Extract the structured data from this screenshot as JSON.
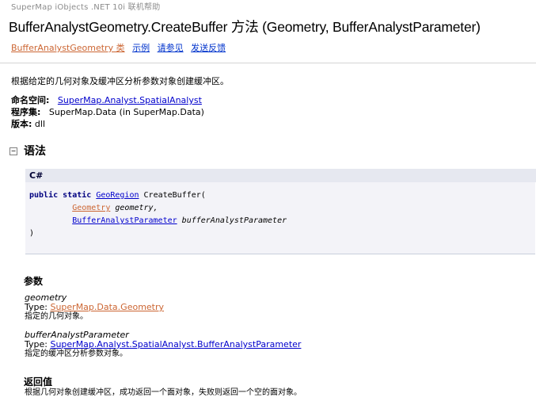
{
  "header": {
    "banner": "SuperMap iObjects .NET 10i 联机帮助",
    "title": "BufferAnalystGeometry.CreateBuffer 方法  (Geometry, BufferAnalystParameter)",
    "links": {
      "class_link": "BufferAnalystGeometry 类",
      "example": "示例",
      "see_also": "请参见",
      "feedback": "发送反馈"
    }
  },
  "description": "根据给定的几何对象及缓冲区分析参数对象创建缓冲区。",
  "meta": {
    "namespace_label": "命名空间:",
    "namespace_value": "SuperMap.Analyst.SpatialAnalyst",
    "assembly_label": "程序集:",
    "assembly_value": "SuperMap.Data (in SuperMap.Data)",
    "version_label": "版本:",
    "version_value": "dll"
  },
  "syntax": {
    "section_title": "语法",
    "toggle": "−",
    "language": "C#",
    "kw_public": "public",
    "kw_static": "static",
    "return_type": "GeoRegion",
    "method": "CreateBuffer(",
    "param1_type": "Geometry",
    "param1_name": "geometry,",
    "param2_type": "BufferAnalystParameter",
    "param2_name": "bufferAnalystParameter",
    "close": ")"
  },
  "parameters": {
    "heading": "参数",
    "items": [
      {
        "name": "geometry",
        "type_label": "Type: ",
        "type": "SuperMap.Data.Geometry",
        "desc": "指定的几何对象。"
      },
      {
        "name": "bufferAnalystParameter",
        "type_label": "Type: ",
        "type": "SuperMap.Analyst.SpatialAnalyst.BufferAnalystParameter",
        "desc": "指定的缓冲区分析参数对象。"
      }
    ]
  },
  "return_value": {
    "heading": "返回值",
    "desc": "根据几何对象创建缓冲区，成功返回一个面对象，失败则返回一个空的面对象。"
  }
}
